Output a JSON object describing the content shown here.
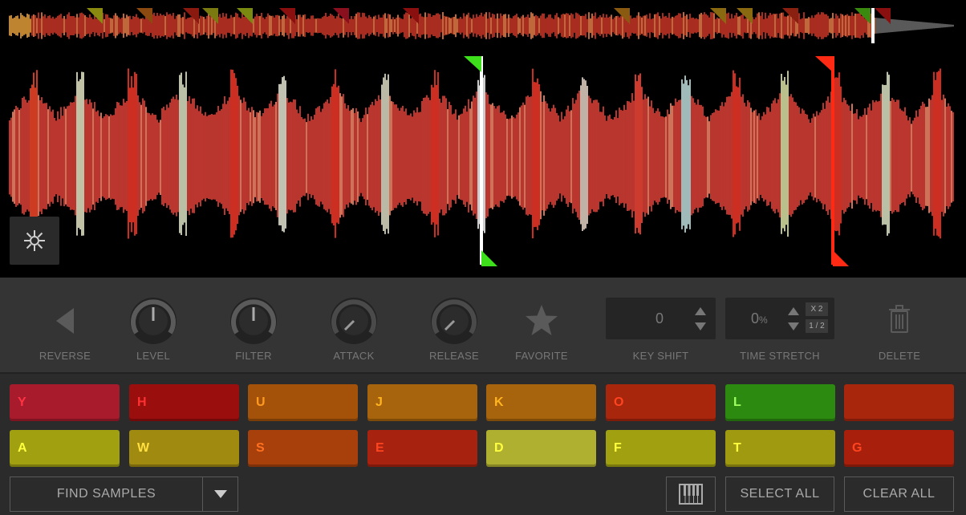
{
  "controls": {
    "reverse_label": "REVERSE",
    "level_label": "LEVEL",
    "filter_label": "FILTER",
    "attack_label": "ATTACK",
    "release_label": "RELEASE",
    "favorite_label": "FAVORITE",
    "key_shift_label": "KEY SHIFT",
    "key_shift_value": "0",
    "time_stretch_label": "TIME STRETCH",
    "time_stretch_value": "0",
    "time_stretch_unit": "%",
    "time_stretch_double": "X 2",
    "time_stretch_half": "1 / 2",
    "delete_label": "DELETE"
  },
  "pads": [
    {
      "label": "Y",
      "color": "#a81b2c",
      "text_color": "#ff3344"
    },
    {
      "label": "H",
      "color": "#9a0e0e",
      "text_color": "#ff3030"
    },
    {
      "label": "U",
      "color": "#a4520a",
      "text_color": "#ff9a20"
    },
    {
      "label": "J",
      "color": "#a8640c",
      "text_color": "#ffb420"
    },
    {
      "label": "K",
      "color": "#a8640c",
      "text_color": "#ffb420"
    },
    {
      "label": "O",
      "color": "#a8260c",
      "text_color": "#ff4420"
    },
    {
      "label": "L",
      "color": "#2c8a10",
      "text_color": "#a0ff60"
    },
    {
      "label": "",
      "color": "#a8260c",
      "text_color": "#ff4420"
    },
    {
      "label": "A",
      "color": "#a0a010",
      "text_color": "#ffff40"
    },
    {
      "label": "W",
      "color": "#a08a10",
      "text_color": "#ffe040"
    },
    {
      "label": "S",
      "color": "#a8400c",
      "text_color": "#ff7020"
    },
    {
      "label": "E",
      "color": "#a82210",
      "text_color": "#ff4420"
    },
    {
      "label": "D",
      "color": "#b0b030",
      "text_color": "#ffff40"
    },
    {
      "label": "F",
      "color": "#a0a010",
      "text_color": "#ffff40"
    },
    {
      "label": "T",
      "color": "#a09a10",
      "text_color": "#ffff40"
    },
    {
      "label": "G",
      "color": "#a8200c",
      "text_color": "#ff4420"
    }
  ],
  "footer": {
    "find_samples_label": "FIND SAMPLES",
    "select_all_label": "SELECT ALL",
    "clear_all_label": "CLEAR ALL"
  },
  "icons": {
    "freeze": "snowflake-sun-icon",
    "reverse": "play-reverse-icon",
    "favorite": "star-icon",
    "delete": "trash-icon",
    "dropdown": "chevron-down-icon",
    "keyboard": "piano-keyboard-icon"
  },
  "colors": {
    "waveform_red": "#ff3d2a",
    "waveform_orange": "#ff8c3a",
    "cue_green": "#3ee01c",
    "cue_red": "#ff2a14"
  }
}
